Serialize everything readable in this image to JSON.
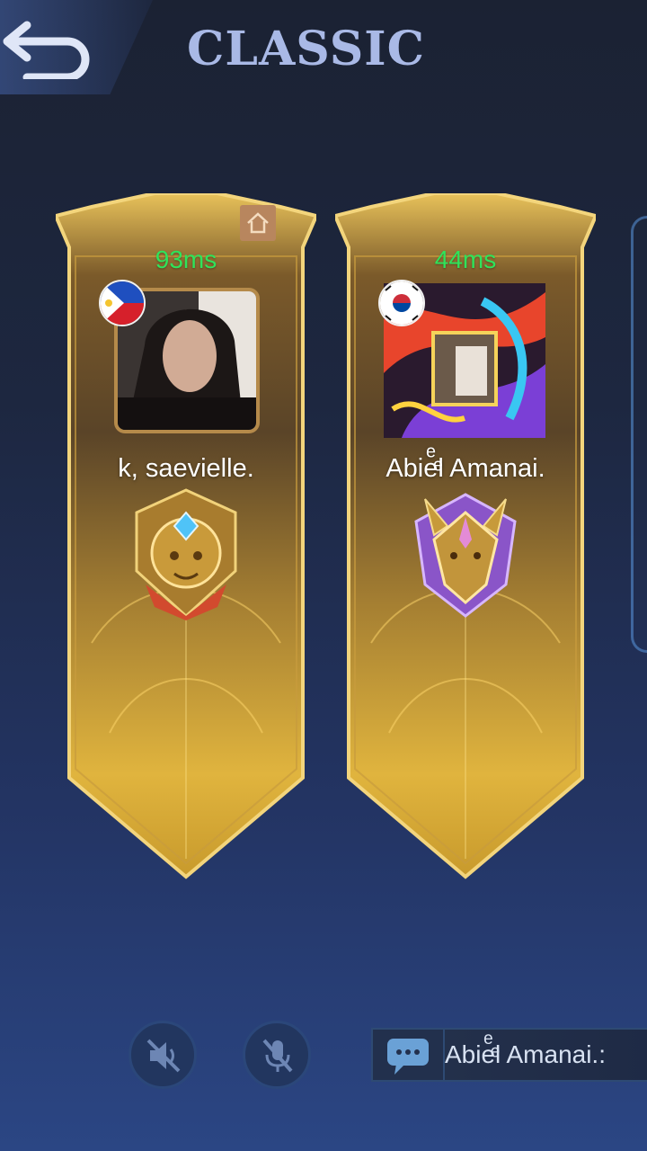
{
  "header": {
    "title": "CLASSIC",
    "back_icon": "back-arrow-icon"
  },
  "players": [
    {
      "ping": "93ms",
      "name": "k, saevielle.",
      "flag": "philippines-flag-icon",
      "is_host": true,
      "rank_icon": "lion-rank-emblem-icon"
    },
    {
      "ping": "44ms",
      "name": "Abieͤͤl Amanai.",
      "flag": "south-korea-flag-icon",
      "is_host": false,
      "rank_icon": "dragon-rank-emblem-icon"
    }
  ],
  "controls": {
    "speaker_icon": "speaker-muted-icon",
    "mic_icon": "microphone-muted-icon"
  },
  "chat": {
    "icon": "chat-bubble-icon",
    "preview": "Abieͤͤl Amanai.:"
  },
  "colors": {
    "ping": "#2fe35a",
    "title": "#a9b9e6",
    "gold": "#d8aa3c"
  }
}
